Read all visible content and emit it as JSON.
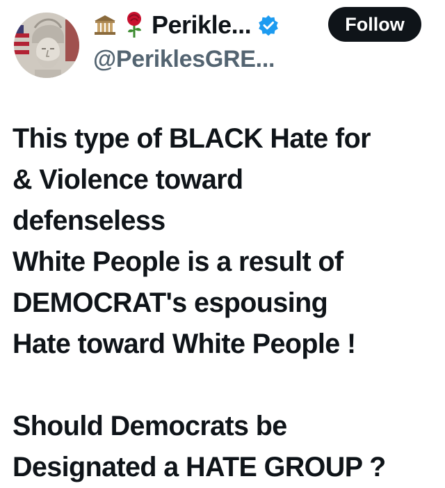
{
  "author": {
    "display_name": "Perikle...",
    "handle": "@PeriklesGRE...",
    "emojis": [
      "classical-building-icon",
      "rose-icon"
    ],
    "verified": true
  },
  "follow_button": {
    "label": "Follow"
  },
  "tweet": {
    "paragraph1": [
      "This type of BLACK Hate for",
      "& Violence toward",
      "defenseless",
      "White People is a result of",
      "DEMOCRAT's espousing",
      "Hate toward White People !"
    ],
    "paragraph2": [
      "Should Democrats be",
      "Designated a HATE GROUP ?"
    ]
  },
  "colors": {
    "text_primary": "#0f1419",
    "text_secondary": "#536471",
    "verified_blue": "#1d9bf0",
    "follow_bg": "#0f1419",
    "follow_text": "#ffffff"
  }
}
